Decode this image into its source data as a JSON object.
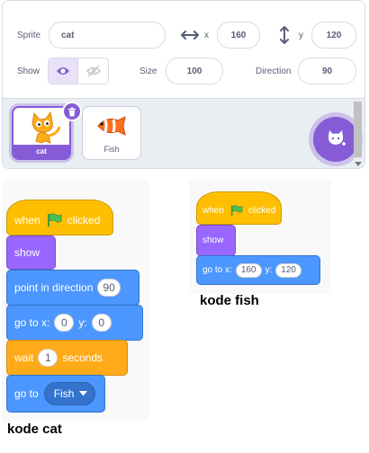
{
  "sprite_info": {
    "sprite_label": "Sprite",
    "sprite_name": "cat",
    "x_label": "x",
    "x_value": "160",
    "y_label": "y",
    "y_value": "120",
    "show_label": "Show",
    "size_label": "Size",
    "size_value": "100",
    "direction_label": "Direction",
    "direction_value": "90",
    "visible": true
  },
  "sprites": [
    {
      "name": "cat",
      "selected": true
    },
    {
      "name": "Fish",
      "selected": false
    }
  ],
  "cat_script": {
    "hat": {
      "when": "when",
      "clicked": "clicked"
    },
    "show": "show",
    "point": {
      "label": "point in direction",
      "value": "90"
    },
    "goto_xy": {
      "label": "go to x:",
      "x": "0",
      "y_label": "y:",
      "y": "0"
    },
    "wait": {
      "label": "wait",
      "value": "1",
      "unit": "seconds"
    },
    "goto": {
      "label": "go to",
      "target": "Fish"
    }
  },
  "fish_script": {
    "hat": {
      "when": "when",
      "clicked": "clicked"
    },
    "show": "show",
    "goto_xy": {
      "label": "go to x:",
      "x": "160",
      "y_label": "y:",
      "y": "120"
    }
  },
  "captions": {
    "cat": "kode cat",
    "fish": "kode fish"
  },
  "colors": {
    "accent": "#855cd6",
    "events": "#ffbf00",
    "looks": "#9966ff",
    "motion": "#4c97ff",
    "control": "#ffab19",
    "flag": "#4cbf56"
  }
}
